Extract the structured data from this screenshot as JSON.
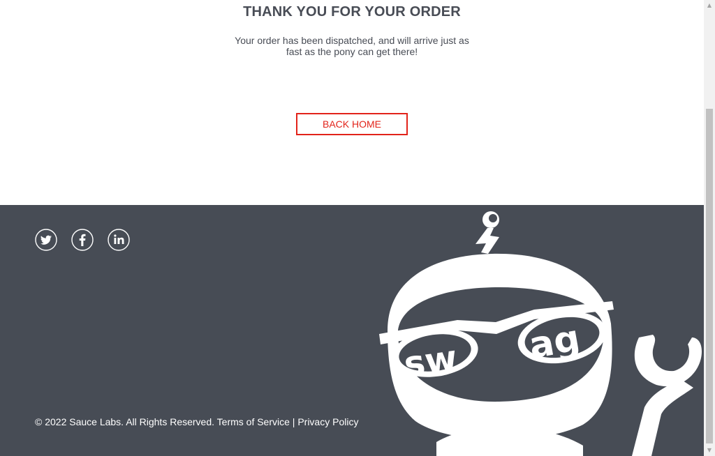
{
  "checkout_complete": {
    "header": "THANK YOU FOR YOUR ORDER",
    "text": "Your order has been dispatched, and will arrive just as fast as the pony can get there!",
    "back_button": "BACK HOME"
  },
  "footer": {
    "social": [
      {
        "name": "twitter",
        "icon": "twitter-icon"
      },
      {
        "name": "facebook",
        "icon": "facebook-icon"
      },
      {
        "name": "linkedin",
        "icon": "linkedin-icon"
      }
    ],
    "copy": "© 2022 Sauce Labs. All Rights Reserved. Terms of Service | Privacy Policy",
    "mascot_text": "swag"
  },
  "colors": {
    "accent": "#e2231a",
    "footer_bg": "#474c55",
    "text": "#484c55"
  }
}
